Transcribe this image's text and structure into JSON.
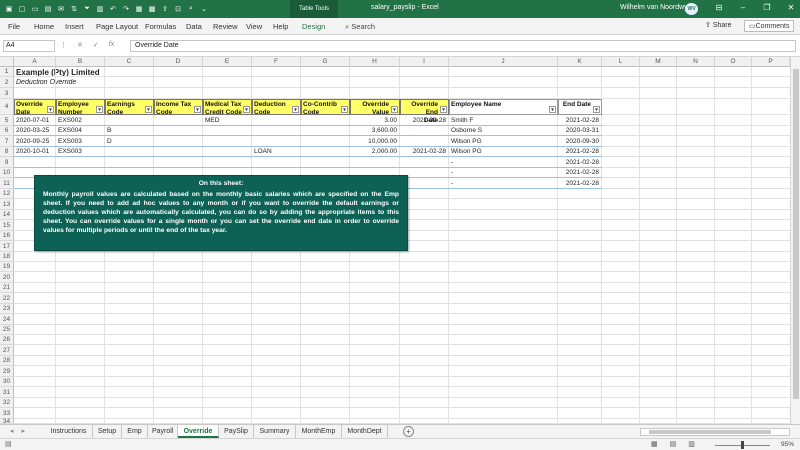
{
  "window": {
    "doc_title": "salary_payslip  -  Excel",
    "table_tools": "Table Tools",
    "user_name": "Wilhelm van Noordwyk",
    "user_initials": "WV"
  },
  "ribbon": {
    "tabs": [
      "File",
      "Home",
      "Insert",
      "Page Layout",
      "Formulas",
      "Data",
      "Review",
      "View",
      "Help",
      "Design"
    ],
    "search": "Search",
    "share": "Share",
    "comments": "Comments"
  },
  "formula_bar": {
    "name_box": "A4",
    "content": "Override Date"
  },
  "columns": [
    "A",
    "B",
    "C",
    "D",
    "E",
    "F",
    "G",
    "H",
    "I",
    "J",
    "K",
    "L",
    "M",
    "N",
    "O",
    "P"
  ],
  "rows": [
    "1",
    "2",
    "3",
    "4",
    "5",
    "6",
    "7",
    "8",
    "9",
    "10",
    "11",
    "12",
    "13",
    "14",
    "15",
    "16",
    "17",
    "18",
    "19",
    "20",
    "21",
    "22",
    "23",
    "24",
    "25",
    "26",
    "27",
    "28",
    "29",
    "30",
    "31",
    "32",
    "33",
    "34"
  ],
  "sheet": {
    "title": "Example (Pty) Limited",
    "subtitle": "Deduction Override",
    "headers": [
      "Override Date",
      "Employee Number",
      "Earnings Code",
      "Income Tax Code",
      "Medical Tax Credit Code",
      "Deduction Code",
      "Co-Contrib Code",
      "Override Value",
      "Override End Date",
      "Employee Name",
      "End Date"
    ],
    "header_lines": [
      [
        "Override",
        "Date"
      ],
      [
        "Employee",
        "Number"
      ],
      [
        "Earnings",
        "Code"
      ],
      [
        "Income Tax",
        "Code"
      ],
      [
        "Medical Tax",
        "Credit Code"
      ],
      [
        "Deduction",
        "Code"
      ],
      [
        "Co-Contrib",
        "Code"
      ],
      [
        "Override",
        "Value"
      ],
      [
        "Override End",
        "Date"
      ],
      [
        "",
        "Employee Name"
      ],
      [
        "",
        "End Date"
      ]
    ],
    "data_rows": [
      [
        "2020-07-01",
        "EXS002",
        "",
        "",
        "MED",
        "",
        "",
        "3.00",
        "2021-02-28",
        "Smith F",
        "2021-02-28"
      ],
      [
        "2020-03-25",
        "EXS004",
        "B",
        "",
        "",
        "",
        "",
        "3,600.00",
        "",
        "Osborne S",
        "2020-03-31"
      ],
      [
        "2020-09-25",
        "EXS003",
        "D",
        "",
        "",
        "",
        "",
        "10,000.00",
        "",
        "Wilson PG",
        "2020-09-30"
      ],
      [
        "2020-10-01",
        "EXS003",
        "",
        "",
        "",
        "LOAN",
        "",
        "2,000.00",
        "2021-02-28",
        "Wilson PG",
        "2021-02-28"
      ],
      [
        "",
        "",
        "",
        "",
        "",
        "",
        "",
        "",
        "",
        "-",
        "2021-02-28"
      ],
      [
        "",
        "",
        "",
        "",
        "",
        "",
        "",
        "",
        "",
        "-",
        "2021-02-28"
      ],
      [
        "",
        "",
        "",
        "",
        "",
        "",
        "",
        "",
        "",
        "-",
        "2021-02-28"
      ]
    ]
  },
  "note": {
    "title": "On this sheet:",
    "body": "Monthly payroll values are calculated based on the monthly basic salaries which are specified on the Emp sheet. If you need to add ad hoc values to any month or if you want to override the default earnings or deduction values which are automatically calculated, you can do so by adding the appropriate items to this sheet. You can override values for a single month or you can set the override end date in order to override values for multiple periods or until the end of the tax year."
  },
  "sheet_tabs": [
    "Instructions",
    "Setup",
    "Emp",
    "Payroll",
    "Override",
    "PaySlip",
    "Summary",
    "MonthEmp",
    "MonthDept"
  ],
  "active_sheet": "Override",
  "status": {
    "zoom": "95%"
  },
  "colors": {
    "excel_green": "#217346",
    "header_yellow": "#ffff66",
    "note_teal": "#0d6155"
  }
}
